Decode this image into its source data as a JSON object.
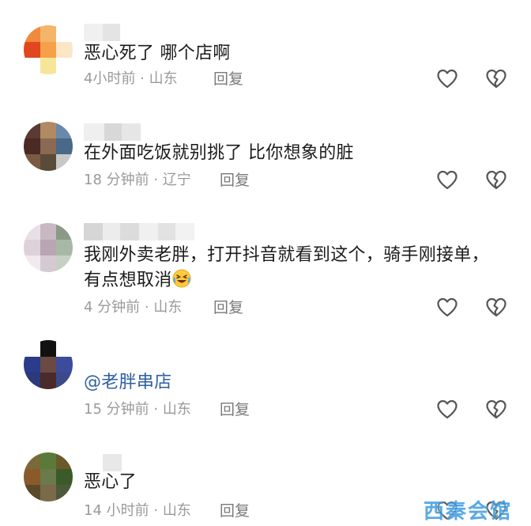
{
  "comments": [
    {
      "text": "恶心死了 哪个店啊",
      "time": "4小时前",
      "location": "山东",
      "reply_label": "回复",
      "like_icon": "heart-outline-icon",
      "dislike_icon": "broken-heart-icon"
    },
    {
      "text": "在外面吃饭就别挑了 比你想象的脏",
      "time": "18 分钟前",
      "location": "辽宁",
      "reply_label": "回复",
      "like_icon": "heart-outline-icon",
      "dislike_icon": "broken-heart-icon"
    },
    {
      "text": "我刚外卖老胖，打开抖音就看到这个，骑手刚接单，有点想取消",
      "emoji": "rolling-laughing-emoji-icon",
      "time": "4 分钟前",
      "location": "山东",
      "reply_label": "回复",
      "like_icon": "heart-outline-icon",
      "dislike_icon": "broken-heart-icon"
    },
    {
      "text": "@老胖串店",
      "time": "15 分钟前",
      "location": "山东",
      "reply_label": "回复",
      "like_icon": "heart-outline-icon",
      "dislike_icon": "broken-heart-icon"
    },
    {
      "text": "恶心了",
      "time": "14 小时前",
      "location": "山东",
      "reply_label": "回复",
      "like_icon": "heart-outline-icon",
      "dislike_icon": "broken-heart-icon"
    }
  ],
  "meta_separator": " · ",
  "watermark": "西秦会馆",
  "colors": {
    "text": "#1b1b1b",
    "meta": "#9a9a9a",
    "mention": "#2f5fa0",
    "watermark": "#3b9ce0"
  }
}
